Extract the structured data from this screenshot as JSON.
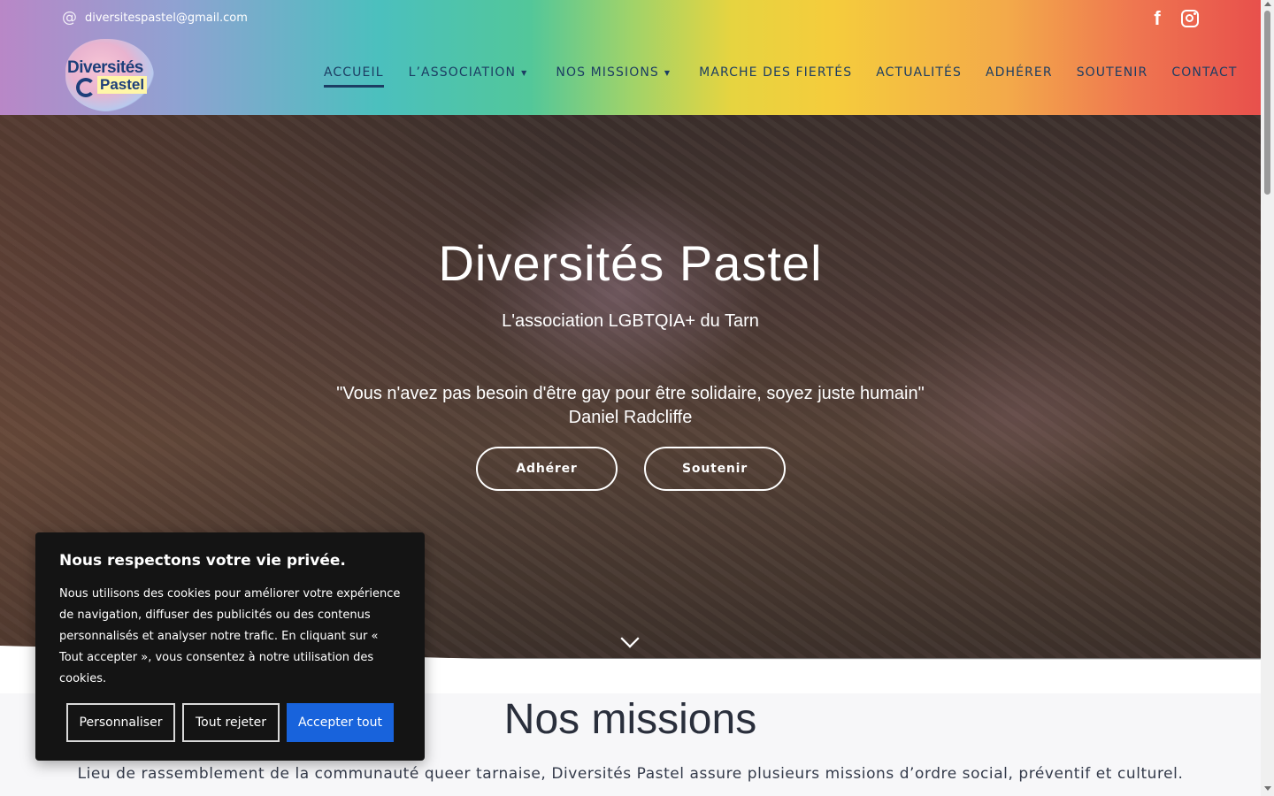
{
  "topbar": {
    "email": "diversitespastel@gmail.com",
    "email_icon": "at-icon",
    "social": [
      "facebook-icon",
      "instagram-icon"
    ]
  },
  "logo": {
    "line1": "Diversités",
    "line2": "Pastel"
  },
  "nav": {
    "items": [
      {
        "label": "ACCUEIL",
        "active": true
      },
      {
        "label": "L’ASSOCIATION",
        "dropdown": true
      },
      {
        "label": "NOS MISSIONS",
        "dropdown": true
      },
      {
        "label": "MARCHE DES FIERTÉS"
      },
      {
        "label": "ACTUALITÉS"
      },
      {
        "label": "ADHÉRER"
      },
      {
        "label": "SOUTENIR"
      },
      {
        "label": "CONTACT"
      }
    ],
    "caret": "▼"
  },
  "hero": {
    "title": "Diversités Pastel",
    "subtitle": "L'association LGBTQIA+ du Tarn",
    "quote": "\"Vous n'avez pas besoin d'être gay pour être solidaire, soyez juste humain\"",
    "quote_author": "Daniel Radcliffe",
    "btn_join": "Adhérer",
    "btn_support": "Soutenir"
  },
  "missions": {
    "title": "Nos missions",
    "text": "Lieu de rassemblement de la communauté queer tarnaise, Diversités Pastel assure plusieurs missions d’ordre social, préventif et culturel."
  },
  "cookie": {
    "title": "Nous respectons votre vie privée.",
    "text": "Nous utilisons des cookies pour améliorer votre expérience de navigation, diffuser des publicités ou des contenus personnalisés et analyser notre trafic. En cliquant sur « Tout accepter », vous consentez à notre utilisation des cookies.",
    "btn_customize": "Personnaliser",
    "btn_reject": "Tout rejeter",
    "btn_accept": "Accepter tout"
  },
  "colors": {
    "nav_text": "#1c3d63",
    "accept_button": "#1863dc",
    "cookie_bg": "#141414"
  }
}
